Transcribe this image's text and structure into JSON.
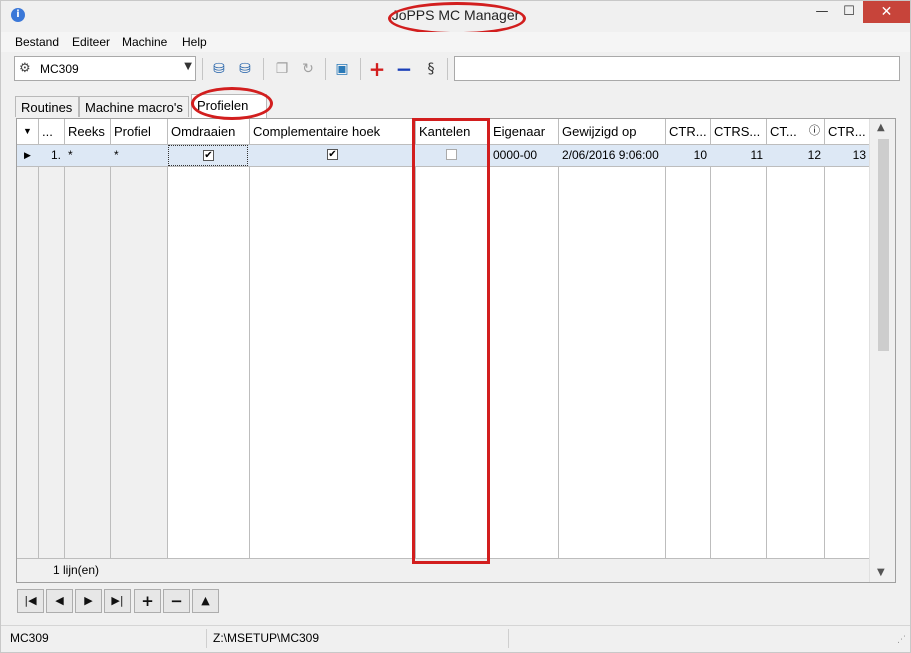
{
  "window": {
    "title": "JoPPS MC Manager",
    "minimize_glyph": "—",
    "maximize_glyph": "☐",
    "close_glyph": "✕",
    "icon": "info-icon"
  },
  "menu": [
    "Bestand",
    "Editeer",
    "Machine",
    "Help"
  ],
  "toolbar": {
    "machine_select": "MC309",
    "search_value": ""
  },
  "tabs": [
    {
      "label": "Routines",
      "active": false
    },
    {
      "label": "Machine macro's",
      "active": false
    },
    {
      "label": "Profielen",
      "active": true
    }
  ],
  "grid": {
    "columns": [
      "",
      "...",
      "Reeks",
      "Profiel",
      "Omdraaien",
      "Complementaire hoek",
      "Kantelen",
      "Eigenaar",
      "Gewijzigd op",
      "CTR...",
      "CTRS...",
      "CT...",
      "CTR..."
    ],
    "rows": [
      {
        "index": "1.",
        "reeks": "*",
        "profiel": "*",
        "omdraaien": true,
        "complementaire_hoek": true,
        "kantelen": false,
        "eigenaar": "0000-00",
        "gewijzigd_op": "2/06/2016 9:06:00",
        "ctr1": "10",
        "ctrs": "11",
        "ct": "12",
        "ctr2": "13"
      }
    ],
    "footer": "1  lijn(en)"
  },
  "statusbar": {
    "machine": "MC309",
    "path": "Z:\\MSETUP\\MC309"
  },
  "colors": {
    "annotation_red": "#d21e1e",
    "selected_row": "#dde8f5",
    "close_button": "#c7443a"
  }
}
